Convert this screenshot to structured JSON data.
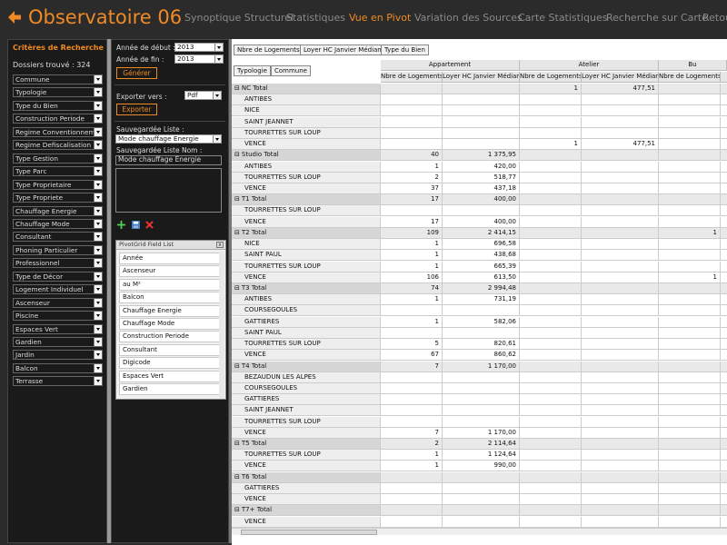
{
  "app": {
    "title": "Observatoire 06"
  },
  "nav": [
    "Synoptique Structurel",
    "Statistiques",
    "Vue en Pivot",
    "Variation des Sources",
    "Carte Statistiques",
    "Recherche sur Carte",
    "Retou"
  ],
  "nav_active": "Vue en Pivot",
  "criteria": {
    "title": "Critères de Recherche",
    "count_label": "Dossiers trouvé : 324",
    "filters": [
      "Commune",
      "Typologie",
      "Type du Bien",
      "Construction Periode",
      "Regime Conventionnement",
      "Regime Defiscalisation",
      "Type Gestion",
      "Type Parc",
      "Type Proprietaire",
      "Type Propriete",
      "Chauffage Energie",
      "Chauffage Mode",
      "Consultant",
      "Phoning Particulier",
      "Professionnel",
      "Type de Décor",
      "Logement Individuel",
      "Ascenseur",
      "Piscine",
      "Espaces Vert",
      "Gardien",
      "Jardin",
      "Balcon",
      "Terrasse"
    ]
  },
  "options": {
    "annee_debut_label": "Année de début :",
    "annee_debut": "2013",
    "annee_fin_label": "Année de fin :",
    "annee_fin": "2013",
    "generer": "Générer",
    "exporter_label": "Exporter vers :",
    "export_format": "Pdf",
    "exporter": "Exporter",
    "saved_list_label": "Sauvegardée Liste :",
    "saved_list_value": "Mode chauffage Energie",
    "saved_name_label": "Sauvegardée Liste Nom :",
    "saved_name_value": "Mode chauffage Energie"
  },
  "field_list": {
    "title": "PivotGrid Field List",
    "close": "x",
    "items": [
      "Année",
      "Ascenseur",
      "au M²",
      "Balcon",
      "Chauffage Energie",
      "Chauffage Mode",
      "Construction Periode",
      "Consultant",
      "Digicode",
      "Espaces Vert",
      "Gardien"
    ]
  },
  "pivot": {
    "header_buttons": [
      "Nbre de Logements",
      "Loyer HC Janvier Médiane",
      "Type du Bien"
    ],
    "row_buttons": [
      "Typologie",
      "Commune"
    ],
    "column_groups": [
      "Appartement",
      "Atelier",
      "Bu"
    ],
    "measures": [
      "Nbre de Logements",
      "Loyer HC Janvier Médiane",
      "Nbre de Logements",
      "Loyer HC Janvier Médiane",
      "Nbre de Logements",
      "L"
    ],
    "rows": [
      {
        "label": "NC Total",
        "total": true,
        "expand": "⊟",
        "v": [
          "",
          "",
          "1",
          "477,51",
          "",
          ""
        ]
      },
      {
        "label": "ANTIBES",
        "v": [
          "",
          "",
          "",
          "",
          "",
          ""
        ]
      },
      {
        "label": "NICE",
        "v": [
          "",
          "",
          "",
          "",
          "",
          ""
        ]
      },
      {
        "label": "SAINT JEANNET",
        "v": [
          "",
          "",
          "",
          "",
          "",
          ""
        ]
      },
      {
        "label": "TOURRETTES SUR LOUP",
        "v": [
          "",
          "",
          "",
          "",
          "",
          ""
        ]
      },
      {
        "label": "VENCE",
        "v": [
          "",
          "",
          "1",
          "477,51",
          "",
          ""
        ]
      },
      {
        "label": "Studio Total",
        "total": true,
        "expand": "⊟",
        "v": [
          "40",
          "1 375,95",
          "",
          "",
          "",
          ""
        ]
      },
      {
        "label": "ANTIBES",
        "v": [
          "1",
          "420,00",
          "",
          "",
          "",
          ""
        ]
      },
      {
        "label": "TOURRETTES SUR LOUP",
        "v": [
          "2",
          "518,77",
          "",
          "",
          "",
          ""
        ]
      },
      {
        "label": "VENCE",
        "v": [
          "37",
          "437,18",
          "",
          "",
          "",
          ""
        ]
      },
      {
        "label": "T1 Total",
        "total": true,
        "expand": "⊟",
        "v": [
          "17",
          "400,00",
          "",
          "",
          "",
          ""
        ]
      },
      {
        "label": "TOURRETTES SUR LOUP",
        "v": [
          "",
          "",
          "",
          "",
          "",
          ""
        ]
      },
      {
        "label": "VENCE",
        "v": [
          "17",
          "400,00",
          "",
          "",
          "",
          ""
        ]
      },
      {
        "label": "T2 Total",
        "total": true,
        "expand": "⊟",
        "v": [
          "109",
          "2 414,15",
          "",
          "",
          "1",
          ""
        ]
      },
      {
        "label": "NICE",
        "v": [
          "1",
          "696,58",
          "",
          "",
          "",
          ""
        ]
      },
      {
        "label": "SAINT PAUL",
        "v": [
          "1",
          "438,68",
          "",
          "",
          "",
          ""
        ]
      },
      {
        "label": "TOURRETTES SUR LOUP",
        "v": [
          "1",
          "665,39",
          "",
          "",
          "",
          ""
        ]
      },
      {
        "label": "VENCE",
        "v": [
          "106",
          "613,50",
          "",
          "",
          "1",
          ""
        ]
      },
      {
        "label": "T3 Total",
        "total": true,
        "expand": "⊟",
        "v": [
          "74",
          "2 994,48",
          "",
          "",
          "",
          ""
        ]
      },
      {
        "label": "ANTIBES",
        "v": [
          "1",
          "731,19",
          "",
          "",
          "",
          ""
        ]
      },
      {
        "label": "COURSEGOULES",
        "v": [
          "",
          "",
          "",
          "",
          "",
          ""
        ]
      },
      {
        "label": "GATTIERES",
        "v": [
          "1",
          "582,06",
          "",
          "",
          "",
          ""
        ]
      },
      {
        "label": "SAINT PAUL",
        "v": [
          "",
          "",
          "",
          "",
          "",
          ""
        ]
      },
      {
        "label": "TOURRETTES SUR LOUP",
        "v": [
          "5",
          "820,61",
          "",
          "",
          "",
          ""
        ]
      },
      {
        "label": "VENCE",
        "v": [
          "67",
          "860,62",
          "",
          "",
          "",
          ""
        ]
      },
      {
        "label": "T4 Total",
        "total": true,
        "expand": "⊟",
        "v": [
          "7",
          "1 170,00",
          "",
          "",
          "",
          ""
        ]
      },
      {
        "label": "BEZAUDUN LES ALPES",
        "v": [
          "",
          "",
          "",
          "",
          "",
          ""
        ]
      },
      {
        "label": "COURSEGOULES",
        "v": [
          "",
          "",
          "",
          "",
          "",
          ""
        ]
      },
      {
        "label": "GATTIERES",
        "v": [
          "",
          "",
          "",
          "",
          "",
          ""
        ]
      },
      {
        "label": "SAINT JEANNET",
        "v": [
          "",
          "",
          "",
          "",
          "",
          ""
        ]
      },
      {
        "label": "TOURRETTES SUR LOUP",
        "v": [
          "",
          "",
          "",
          "",
          "",
          ""
        ]
      },
      {
        "label": "VENCE",
        "v": [
          "7",
          "1 170,00",
          "",
          "",
          "",
          ""
        ]
      },
      {
        "label": "T5 Total",
        "total": true,
        "expand": "⊟",
        "v": [
          "2",
          "2 114,64",
          "",
          "",
          "",
          ""
        ]
      },
      {
        "label": "TOURRETTES SUR LOUP",
        "v": [
          "1",
          "1 124,64",
          "",
          "",
          "",
          ""
        ]
      },
      {
        "label": "VENCE",
        "v": [
          "1",
          "990,00",
          "",
          "",
          "",
          ""
        ]
      },
      {
        "label": "T6 Total",
        "total": true,
        "expand": "⊟",
        "v": [
          "",
          "",
          "",
          "",
          "",
          ""
        ]
      },
      {
        "label": "GATTIERES",
        "v": [
          "",
          "",
          "",
          "",
          "",
          ""
        ]
      },
      {
        "label": "VENCE",
        "v": [
          "",
          "",
          "",
          "",
          "",
          ""
        ]
      },
      {
        "label": "T7+ Total",
        "total": true,
        "expand": "⊟",
        "v": [
          "",
          "",
          "",
          "",
          "",
          ""
        ]
      },
      {
        "label": "VENCE",
        "v": [
          "",
          "",
          "",
          "",
          "",
          ""
        ]
      }
    ]
  },
  "colors": {
    "accent": "#f08a24",
    "bg": "#2b2b2b",
    "panel": "#1a1a1a"
  }
}
